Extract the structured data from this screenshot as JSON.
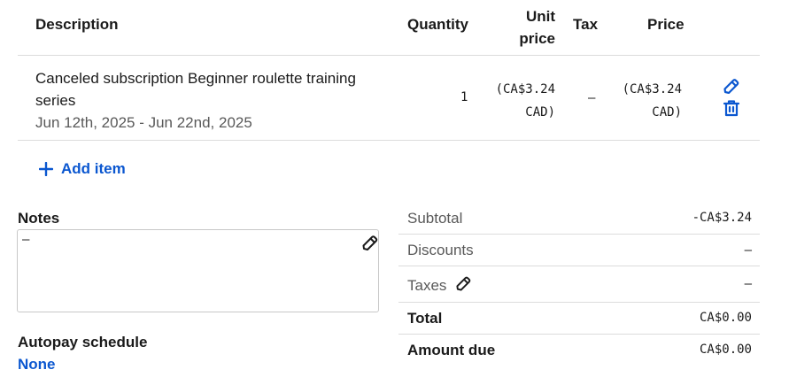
{
  "table": {
    "headers": {
      "description": "Description",
      "quantity": "Quantity",
      "unit_price_line1": "Unit",
      "unit_price_line2": "price",
      "tax": "Tax",
      "price": "Price"
    },
    "rows": [
      {
        "description_line1": "Canceled subscription Beginner roulette training",
        "description_line2": "series",
        "period": "Jun 12th, 2025 - Jun 22nd, 2025",
        "quantity": "1",
        "unit_price_line1": "(CA$3.24",
        "unit_price_line2": "CAD)",
        "tax": "–",
        "price_line1": "(CA$3.24",
        "price_line2": "CAD)",
        "edit_icon": "pencil-icon",
        "delete_icon": "trash-icon"
      }
    ],
    "add_item_label": "Add item"
  },
  "notes": {
    "label": "Notes",
    "value": "–",
    "edit_icon": "pencil-icon"
  },
  "autopay": {
    "label": "Autopay schedule",
    "value": "None"
  },
  "summary": {
    "subtotal_label": "Subtotal",
    "subtotal_value": "-CA$3.24",
    "discounts_label": "Discounts",
    "discounts_value": "–",
    "taxes_label": "Taxes",
    "taxes_value": "–",
    "total_label": "Total",
    "total_value": "CA$0.00",
    "amount_due_label": "Amount due",
    "amount_due_value": "CA$0.00"
  },
  "colors": {
    "accent": "#0b57d0",
    "muted_text": "#595959",
    "divider": "#dcdcdc"
  }
}
